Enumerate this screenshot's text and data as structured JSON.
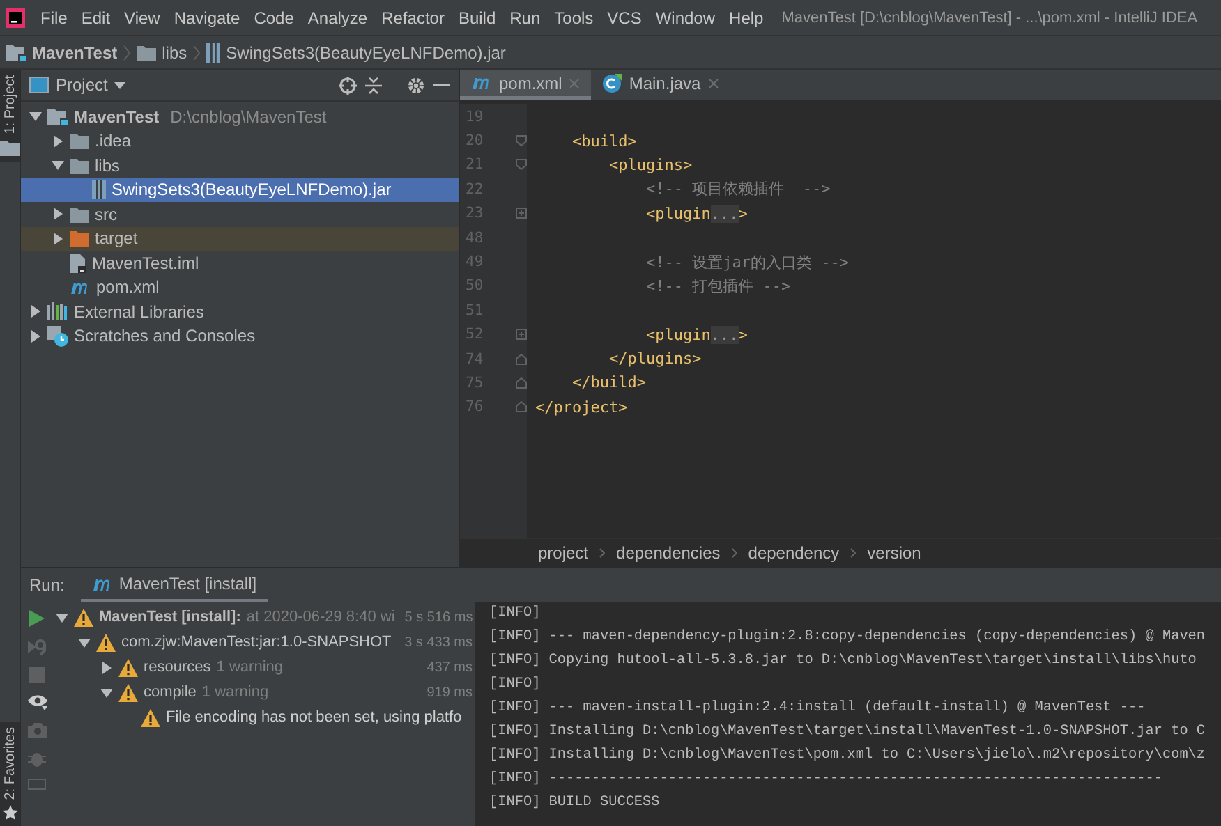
{
  "window": {
    "title": "MavenTest [D:\\cnblog\\MavenTest] - ...\\pom.xml - IntelliJ IDEA"
  },
  "menu": [
    "File",
    "Edit",
    "View",
    "Navigate",
    "Code",
    "Analyze",
    "Refactor",
    "Build",
    "Run",
    "Tools",
    "VCS",
    "Window",
    "Help"
  ],
  "nav_bar": [
    {
      "label": "MavenTest",
      "kind": "module"
    },
    {
      "label": "libs",
      "kind": "folder"
    },
    {
      "label": "SwingSets3(BeautyEyeLNFDemo).jar",
      "kind": "jar"
    }
  ],
  "left_stripe": {
    "top": "1: Project",
    "bottom": "2: Favorites"
  },
  "project_panel": {
    "title": "Project",
    "tree": [
      {
        "label": "MavenTest",
        "hint": "D:\\cnblog\\MavenTest",
        "kind": "module",
        "expanded": true,
        "selected": false,
        "highlighted": false,
        "children": [
          {
            "label": ".idea",
            "kind": "folder",
            "expanded": false,
            "selected": false,
            "highlighted": false
          },
          {
            "label": "libs",
            "kind": "folder",
            "expanded": true,
            "selected": false,
            "highlighted": false,
            "children": [
              {
                "label": "SwingSets3(BeautyEyeLNFDemo).jar",
                "kind": "jar",
                "selected": true,
                "highlighted": false
              }
            ]
          },
          {
            "label": "src",
            "kind": "folder",
            "expanded": false,
            "selected": false,
            "highlighted": false
          },
          {
            "label": "target",
            "kind": "excluded_folder",
            "expanded": false,
            "selected": false,
            "highlighted": true
          },
          {
            "label": "MavenTest.iml",
            "kind": "iml",
            "selected": false,
            "highlighted": false
          },
          {
            "label": "pom.xml",
            "kind": "pom",
            "selected": false,
            "highlighted": false
          }
        ]
      },
      {
        "label": "External Libraries",
        "kind": "libraries",
        "expanded": false,
        "selected": false,
        "highlighted": false
      },
      {
        "label": "Scratches and Consoles",
        "kind": "scratches",
        "expanded": false,
        "selected": false,
        "highlighted": false
      }
    ]
  },
  "editor": {
    "tabs": [
      {
        "label": "pom.xml",
        "kind": "pom",
        "selected": true
      },
      {
        "label": "Main.java",
        "kind": "java",
        "selected": false
      }
    ],
    "lines": [
      {
        "number": "19",
        "kind": "blank"
      },
      {
        "number": "20",
        "kind": "tag",
        "fold_marker": {
          "kind": "open"
        },
        "text": "    <build>"
      },
      {
        "number": "21",
        "kind": "tag",
        "fold_marker": {
          "kind": "open"
        },
        "text": "        <plugins>"
      },
      {
        "number": "22",
        "kind": "comment",
        "text": "            <!-- 项目依赖插件  -->"
      },
      {
        "number": "23",
        "kind": "tag",
        "fold_marker": {
          "kind": "collapsed"
        },
        "text": "            <plugin",
        "folded": "...",
        "tail": ">"
      },
      {
        "number": "48",
        "kind": "blank"
      },
      {
        "number": "49",
        "kind": "comment",
        "text": "            <!-- 设置jar的入口类 -->"
      },
      {
        "number": "50",
        "kind": "comment",
        "text": "            <!-- 打包插件 -->"
      },
      {
        "number": "51",
        "kind": "blank"
      },
      {
        "number": "52",
        "kind": "tag",
        "fold_marker": {
          "kind": "collapsed"
        },
        "text": "            <plugin",
        "folded": "...",
        "tail": ">"
      },
      {
        "number": "74",
        "kind": "tag",
        "fold_marker": {
          "kind": "close"
        },
        "text": "        </plugins>"
      },
      {
        "number": "75",
        "kind": "tag",
        "fold_marker": {
          "kind": "close"
        },
        "text": "    </build>"
      },
      {
        "number": "76",
        "kind": "tag",
        "fold_marker": {
          "kind": "close"
        },
        "text": "</project>"
      }
    ],
    "breadcrumbs": [
      "project",
      "dependencies",
      "dependency",
      "version"
    ]
  },
  "run_panel": {
    "title": "Run:",
    "tab": "MavenTest [install]",
    "tree": [
      {
        "kind": "root",
        "label": "MavenTest [install]:",
        "detail": "at 2020-06-29 8:40 wi",
        "time": "5 s 516 ms",
        "expanded": true,
        "children": [
          {
            "kind": "module",
            "label": "com.zjw:MavenTest:jar:1.0-SNAPSHOT",
            "time": "3 s 433 ms",
            "expanded": true,
            "children": [
              {
                "kind": "phase",
                "label": "resources",
                "detail": "1 warning",
                "time": "437 ms",
                "expanded": false
              },
              {
                "kind": "phase",
                "label": "compile",
                "detail": "1 warning",
                "time": "919 ms",
                "expanded": true,
                "children": [
                  {
                    "kind": "message",
                    "label": "File encoding has not been set, using platfo"
                  }
                ]
              }
            ]
          }
        ]
      }
    ],
    "console": [
      "[INFO]",
      "[INFO] --- maven-dependency-plugin:2.8:copy-dependencies (copy-dependencies) @ Maven",
      "[INFO] Copying hutool-all-5.3.8.jar to D:\\cnblog\\MavenTest\\target\\install\\libs\\huto",
      "[INFO]",
      "[INFO] --- maven-install-plugin:2.4:install (default-install) @ MavenTest ---",
      "[INFO] Installing D:\\cnblog\\MavenTest\\target\\install\\MavenTest-1.0-SNAPSHOT.jar to C",
      "[INFO] Installing D:\\cnblog\\MavenTest\\pom.xml to C:\\Users\\jielo\\.m2\\repository\\com\\z",
      "[INFO] ------------------------------------------------------------------------",
      "[INFO] BUILD SUCCESS"
    ]
  }
}
